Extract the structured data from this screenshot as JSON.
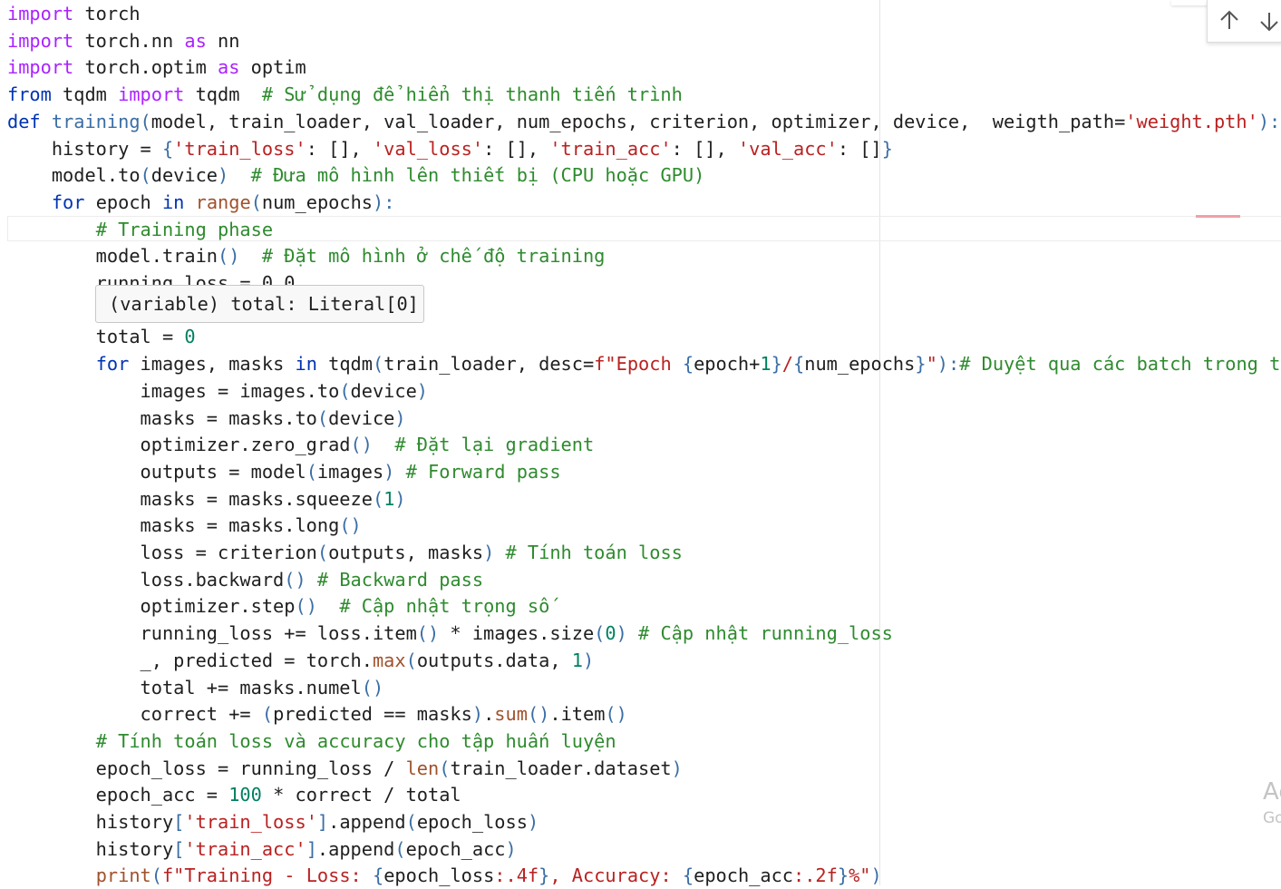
{
  "editor": {
    "lines": [
      [
        {
          "t": "import",
          "c": "kw"
        },
        {
          "t": " torch",
          "c": "id"
        }
      ],
      [
        {
          "t": "import",
          "c": "kw"
        },
        {
          "t": " torch.nn ",
          "c": "id"
        },
        {
          "t": "as",
          "c": "kw"
        },
        {
          "t": " nn",
          "c": "id"
        }
      ],
      [
        {
          "t": "import",
          "c": "kw"
        },
        {
          "t": " torch.optim ",
          "c": "id"
        },
        {
          "t": "as",
          "c": "kw"
        },
        {
          "t": " optim",
          "c": "id"
        }
      ],
      [
        {
          "t": "from",
          "c": "kw2"
        },
        {
          "t": " tqdm ",
          "c": "id"
        },
        {
          "t": "import",
          "c": "kw"
        },
        {
          "t": " tqdm  ",
          "c": "id"
        },
        {
          "t": "# Sử dụng để hiển thị thanh tiến trình",
          "c": "com"
        }
      ],
      [
        {
          "t": "def",
          "c": "kw2"
        },
        {
          "t": " ",
          "c": "id"
        },
        {
          "t": "training",
          "c": "fn"
        },
        {
          "t": "(",
          "c": "par"
        },
        {
          "t": "model, train_loader, val_loader, num_epochs, criterion, optimizer, device,  weigth_path=",
          "c": "id"
        },
        {
          "t": "'weight.pth'",
          "c": "str"
        },
        {
          "t": "):",
          "c": "par"
        }
      ],
      [
        {
          "t": "    history = ",
          "c": "id"
        },
        {
          "t": "{",
          "c": "par"
        },
        {
          "t": "'train_loss'",
          "c": "str"
        },
        {
          "t": ": [], ",
          "c": "id"
        },
        {
          "t": "'val_loss'",
          "c": "str"
        },
        {
          "t": ": [], ",
          "c": "id"
        },
        {
          "t": "'train_acc'",
          "c": "str"
        },
        {
          "t": ": [], ",
          "c": "id"
        },
        {
          "t": "'val_acc'",
          "c": "str"
        },
        {
          "t": ": []",
          "c": "id"
        },
        {
          "t": "}",
          "c": "par"
        }
      ],
      [
        {
          "t": "    model.to",
          "c": "id"
        },
        {
          "t": "(",
          "c": "par"
        },
        {
          "t": "device",
          "c": "id"
        },
        {
          "t": ")",
          "c": "par"
        },
        {
          "t": "  ",
          "c": "id"
        },
        {
          "t": "# Đưa mô hình lên thiết bị (CPU hoặc GPU)",
          "c": "com"
        }
      ],
      [
        {
          "t": "    ",
          "c": "id"
        },
        {
          "t": "for",
          "c": "kw2"
        },
        {
          "t": " epoch ",
          "c": "id"
        },
        {
          "t": "in",
          "c": "kw2"
        },
        {
          "t": " ",
          "c": "id"
        },
        {
          "t": "range",
          "c": "bi"
        },
        {
          "t": "(",
          "c": "par"
        },
        {
          "t": "num_epochs",
          "c": "id"
        },
        {
          "t": "):",
          "c": "par"
        }
      ],
      [
        {
          "t": "        ",
          "c": "id"
        },
        {
          "t": "# Training phase",
          "c": "com"
        }
      ],
      [
        {
          "t": "        model.train",
          "c": "id"
        },
        {
          "t": "()",
          "c": "par"
        },
        {
          "t": "  ",
          "c": "id"
        },
        {
          "t": "# Đặt mô hình ở chế độ training",
          "c": "com"
        }
      ],
      [
        {
          "t": "        running_loss = 0.0",
          "c": "id"
        }
      ],
      [],
      [
        {
          "t": "        total = ",
          "c": "id"
        },
        {
          "t": "0",
          "c": "num"
        }
      ],
      [
        {
          "t": "        ",
          "c": "id"
        },
        {
          "t": "for",
          "c": "kw2"
        },
        {
          "t": " images, masks ",
          "c": "id"
        },
        {
          "t": "in",
          "c": "kw2"
        },
        {
          "t": " tqdm",
          "c": "id"
        },
        {
          "t": "(",
          "c": "par"
        },
        {
          "t": "train_loader, desc=",
          "c": "id"
        },
        {
          "t": "f\"Epoch ",
          "c": "str"
        },
        {
          "t": "{",
          "c": "par"
        },
        {
          "t": "epoch+",
          "c": "id"
        },
        {
          "t": "1",
          "c": "num"
        },
        {
          "t": "}",
          "c": "par"
        },
        {
          "t": "/",
          "c": "str"
        },
        {
          "t": "{",
          "c": "par"
        },
        {
          "t": "num_epochs",
          "c": "id"
        },
        {
          "t": "}",
          "c": "par"
        },
        {
          "t": "\"",
          "c": "str"
        },
        {
          "t": "):",
          "c": "par"
        },
        {
          "t": "# Duyệt qua các batch trong tập",
          "c": "com"
        }
      ],
      [
        {
          "t": "            images = images.to",
          "c": "id"
        },
        {
          "t": "(",
          "c": "par"
        },
        {
          "t": "device",
          "c": "id"
        },
        {
          "t": ")",
          "c": "par"
        }
      ],
      [
        {
          "t": "            masks = masks.to",
          "c": "id"
        },
        {
          "t": "(",
          "c": "par"
        },
        {
          "t": "device",
          "c": "id"
        },
        {
          "t": ")",
          "c": "par"
        }
      ],
      [
        {
          "t": "            optimizer.zero_grad",
          "c": "id"
        },
        {
          "t": "()",
          "c": "par"
        },
        {
          "t": "  ",
          "c": "id"
        },
        {
          "t": "# Đặt lại gradient",
          "c": "com"
        }
      ],
      [
        {
          "t": "            outputs = model",
          "c": "id"
        },
        {
          "t": "(",
          "c": "par"
        },
        {
          "t": "images",
          "c": "id"
        },
        {
          "t": ")",
          "c": "par"
        },
        {
          "t": " ",
          "c": "id"
        },
        {
          "t": "# Forward pass",
          "c": "com"
        }
      ],
      [
        {
          "t": "            masks = masks.squeeze",
          "c": "id"
        },
        {
          "t": "(",
          "c": "par"
        },
        {
          "t": "1",
          "c": "num"
        },
        {
          "t": ")",
          "c": "par"
        }
      ],
      [
        {
          "t": "            masks = masks.long",
          "c": "id"
        },
        {
          "t": "()",
          "c": "par"
        }
      ],
      [
        {
          "t": "            loss = criterion",
          "c": "id"
        },
        {
          "t": "(",
          "c": "par"
        },
        {
          "t": "outputs, masks",
          "c": "id"
        },
        {
          "t": ")",
          "c": "par"
        },
        {
          "t": " ",
          "c": "id"
        },
        {
          "t": "# Tính toán loss",
          "c": "com"
        }
      ],
      [
        {
          "t": "            loss.backward",
          "c": "id"
        },
        {
          "t": "()",
          "c": "par"
        },
        {
          "t": " ",
          "c": "id"
        },
        {
          "t": "# Backward pass",
          "c": "com"
        }
      ],
      [
        {
          "t": "            optimizer.step",
          "c": "id"
        },
        {
          "t": "()",
          "c": "par"
        },
        {
          "t": "  ",
          "c": "id"
        },
        {
          "t": "# Cập nhật trọng số",
          "c": "com"
        }
      ],
      [
        {
          "t": "            running_loss += loss.item",
          "c": "id"
        },
        {
          "t": "()",
          "c": "par"
        },
        {
          "t": " * images.size",
          "c": "id"
        },
        {
          "t": "(",
          "c": "par"
        },
        {
          "t": "0",
          "c": "num"
        },
        {
          "t": ")",
          "c": "par"
        },
        {
          "t": " ",
          "c": "id"
        },
        {
          "t": "# Cập nhật running_loss",
          "c": "com"
        }
      ],
      [
        {
          "t": "            _, predicted = torch.",
          "c": "id"
        },
        {
          "t": "max",
          "c": "bi"
        },
        {
          "t": "(",
          "c": "par"
        },
        {
          "t": "outputs.data, ",
          "c": "id"
        },
        {
          "t": "1",
          "c": "num"
        },
        {
          "t": ")",
          "c": "par"
        }
      ],
      [
        {
          "t": "            total += masks.numel",
          "c": "id"
        },
        {
          "t": "()",
          "c": "par"
        }
      ],
      [
        {
          "t": "            correct += ",
          "c": "id"
        },
        {
          "t": "(",
          "c": "par"
        },
        {
          "t": "predicted == masks",
          "c": "id"
        },
        {
          "t": ")",
          "c": "par"
        },
        {
          "t": ".",
          "c": "id"
        },
        {
          "t": "sum",
          "c": "bi"
        },
        {
          "t": "()",
          "c": "par"
        },
        {
          "t": ".item",
          "c": "id"
        },
        {
          "t": "()",
          "c": "par"
        }
      ],
      [
        {
          "t": "        ",
          "c": "id"
        },
        {
          "t": "# Tính toán loss và accuracy cho tập huấn luyện",
          "c": "com"
        }
      ],
      [
        {
          "t": "        epoch_loss = running_loss / ",
          "c": "id"
        },
        {
          "t": "len",
          "c": "bi"
        },
        {
          "t": "(",
          "c": "par"
        },
        {
          "t": "train_loader.dataset",
          "c": "id"
        },
        {
          "t": ")",
          "c": "par"
        }
      ],
      [
        {
          "t": "        epoch_acc = ",
          "c": "id"
        },
        {
          "t": "100",
          "c": "num"
        },
        {
          "t": " * correct / total",
          "c": "id"
        }
      ],
      [
        {
          "t": "        history",
          "c": "id"
        },
        {
          "t": "[",
          "c": "par"
        },
        {
          "t": "'train_loss'",
          "c": "str"
        },
        {
          "t": "]",
          "c": "par"
        },
        {
          "t": ".append",
          "c": "id"
        },
        {
          "t": "(",
          "c": "par"
        },
        {
          "t": "epoch_loss",
          "c": "id"
        },
        {
          "t": ")",
          "c": "par"
        }
      ],
      [
        {
          "t": "        history",
          "c": "id"
        },
        {
          "t": "[",
          "c": "par"
        },
        {
          "t": "'train_acc'",
          "c": "str"
        },
        {
          "t": "]",
          "c": "par"
        },
        {
          "t": ".append",
          "c": "id"
        },
        {
          "t": "(",
          "c": "par"
        },
        {
          "t": "epoch_acc",
          "c": "id"
        },
        {
          "t": ")",
          "c": "par"
        }
      ],
      [
        {
          "t": "        ",
          "c": "id"
        },
        {
          "t": "print",
          "c": "bi"
        },
        {
          "t": "(",
          "c": "par"
        },
        {
          "t": "f\"Training - Loss: ",
          "c": "str"
        },
        {
          "t": "{",
          "c": "par"
        },
        {
          "t": "epoch_loss",
          "c": "id"
        },
        {
          "t": ":.4f",
          "c": "str"
        },
        {
          "t": "}",
          "c": "par"
        },
        {
          "t": ", Accuracy: ",
          "c": "str"
        },
        {
          "t": "{",
          "c": "par"
        },
        {
          "t": "epoch_acc",
          "c": "id"
        },
        {
          "t": ":.2f",
          "c": "str"
        },
        {
          "t": "}",
          "c": "par"
        },
        {
          "t": "%\"",
          "c": "str"
        },
        {
          "t": ")",
          "c": "par"
        }
      ]
    ]
  },
  "tooltip": {
    "text": "(variable) total: Literal[0]"
  },
  "nav": {
    "up_icon": "arrow-up-icon",
    "down_icon": "arrow-down-icon"
  },
  "watermark": {
    "line1": "Ac",
    "line2": "Go"
  },
  "colors": {
    "keyword": "#aa22ff",
    "keyword_control": "#0033b3",
    "string": "#ba2121",
    "comment": "#2e8b2e",
    "number": "#008060",
    "builtin": "#a0522d"
  }
}
